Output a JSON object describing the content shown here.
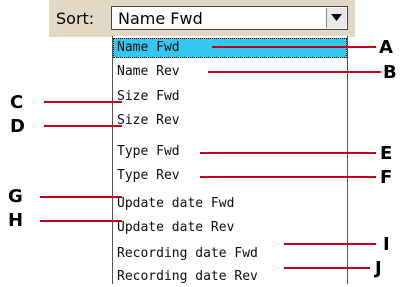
{
  "sort": {
    "label": "Sort:",
    "selected_value": "Name Fwd"
  },
  "options": [
    {
      "label": "Name Fwd",
      "selected": true
    },
    {
      "label": "Name Rev"
    },
    {
      "label": "Size Fwd"
    },
    {
      "label": "Size Rev"
    },
    {
      "label": "Type Fwd"
    },
    {
      "label": "Type Rev"
    },
    {
      "label": "Update date Fwd"
    },
    {
      "label": "Update date Rev"
    },
    {
      "label": "Recording date Fwd"
    },
    {
      "label": "Recording date Rev"
    }
  ],
  "callouts": [
    "A",
    "B",
    "C",
    "D",
    "E",
    "F",
    "G",
    "H",
    "I",
    "J"
  ],
  "colors": {
    "callout_line": "#c0001a",
    "selection": "#33c8f0",
    "panel": "#e2d8c6"
  }
}
